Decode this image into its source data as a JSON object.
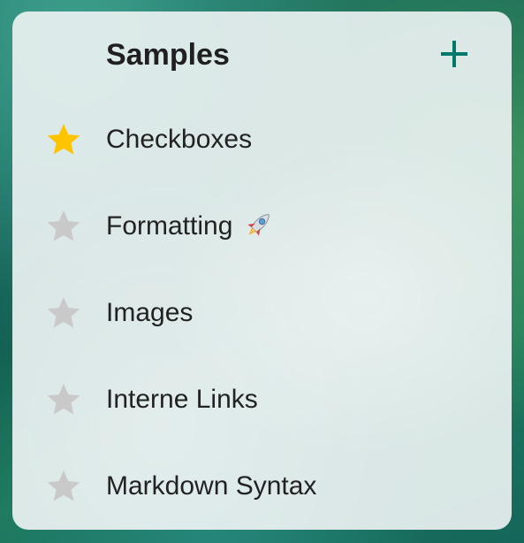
{
  "widget": {
    "title": "Samples",
    "add_icon": "plus-icon",
    "accent_color": "#00796b",
    "items": [
      {
        "label": "Checkboxes",
        "starred": true,
        "emoji": ""
      },
      {
        "label": "Formatting",
        "starred": false,
        "emoji": "rocket"
      },
      {
        "label": "Images",
        "starred": false,
        "emoji": ""
      },
      {
        "label": "Interne Links",
        "starred": false,
        "emoji": ""
      },
      {
        "label": "Markdown Syntax",
        "starred": false,
        "emoji": ""
      }
    ]
  },
  "colors": {
    "star_active": "#ffc400",
    "star_inactive": "#c9c9c9",
    "text": "#222222"
  }
}
